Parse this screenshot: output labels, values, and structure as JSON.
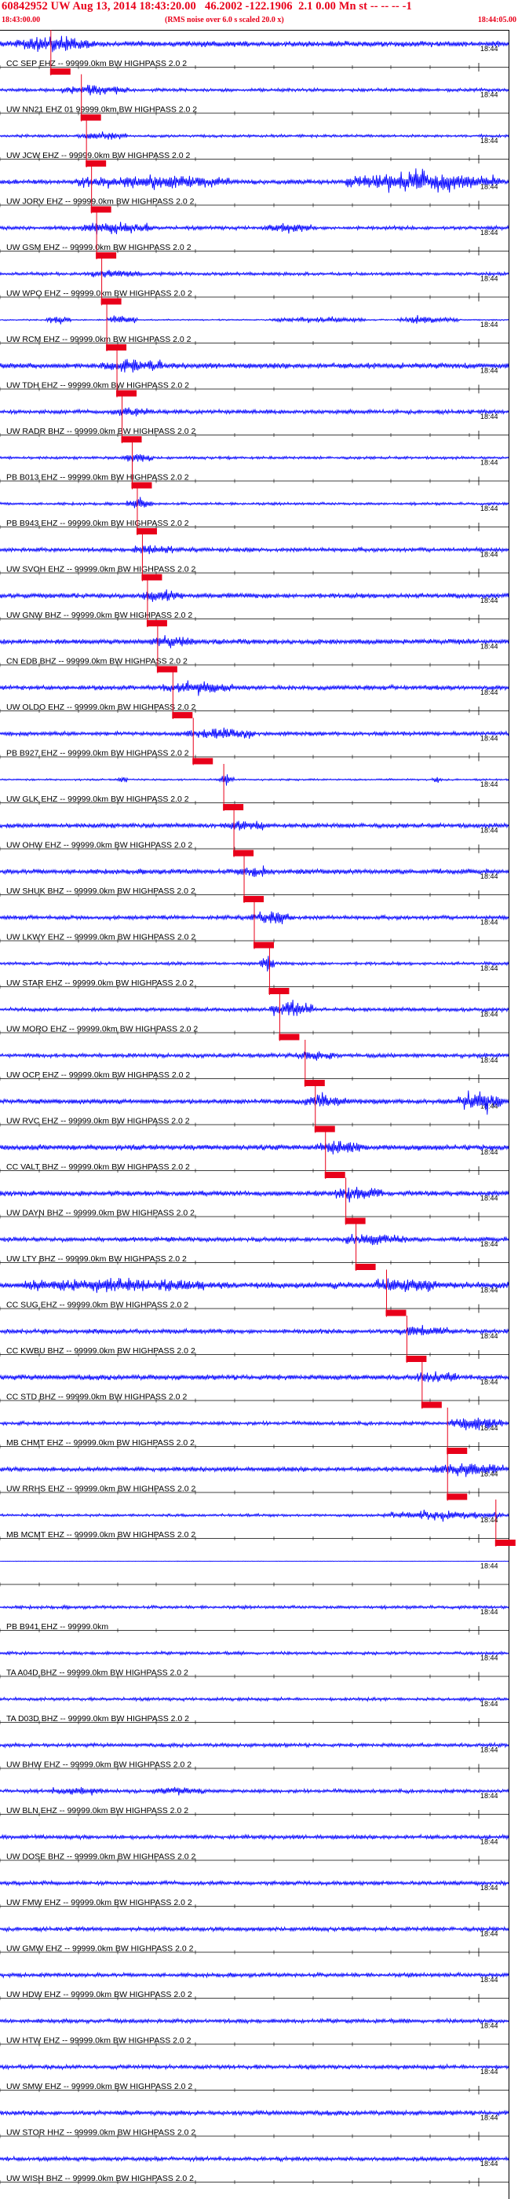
{
  "header": {
    "title": "60842952 UW Aug 13, 2014 18:43:20.00   46.2002 -122.1906  2.1 0.00 Mn st -- -- -- -1",
    "start_time": "18:43:00.00",
    "note": "(RMS noise over 6.0 s scaled 20.0 x)",
    "end_time": "18:44:05.00"
  },
  "chart_data": {
    "type": "seismogram",
    "title": "60842952 UW Aug 13, 2014 18:43:20.00   46.2002 -122.1906  2.1 0.00 Mn st -- -- -- -1",
    "x_range_label": [
      "18:43:00.00",
      "18:44:05.00"
    ],
    "minute_tick_label": "18:44",
    "colors": {
      "trace": "#0000ff",
      "pick": "#e8001a",
      "axis": "#000000"
    },
    "traces": [
      {
        "label": "CC SEP EHZ -- 99999.0km BW  HIGHPASS  2.0  2",
        "amp": 0.6,
        "bursts": [
          [
            0.03,
            0.18,
            2.0
          ]
        ],
        "pick": 0.1
      },
      {
        "label": "UW NN21 EHZ 01 99999.0km BW  HIGHPASS  2.0  2",
        "amp": 0.35,
        "bursts": [
          [
            0.12,
            0.25,
            2.5
          ]
        ],
        "pick": 0.16
      },
      {
        "label": "UW JCW EHZ -- 99999.0km BW  HIGHPASS  2.0  2",
        "amp": 0.3,
        "bursts": [
          [
            0.15,
            0.25,
            2.0
          ]
        ],
        "pick": 0.17
      },
      {
        "label": "UW JORV EHZ -- 99999.0km BW  HIGHPASS  2.0  2",
        "amp": 0.5,
        "bursts": [
          [
            0.15,
            0.45,
            2.2
          ],
          [
            0.68,
            0.99,
            3.5
          ]
        ],
        "pick": 0.18
      },
      {
        "label": "UW GSM EHZ -- 99999.0km BW  HIGHPASS  2.0  2",
        "amp": 0.4,
        "bursts": [
          [
            0.16,
            0.3,
            2.5
          ],
          [
            0.52,
            0.62,
            1.5
          ]
        ],
        "pick": 0.19
      },
      {
        "label": "UW WPO EHZ -- 99999.0km BW  HIGHPASS  2.0  2",
        "amp": 0.35,
        "bursts": [
          [
            0.17,
            0.28,
            1.5
          ]
        ],
        "pick": 0.2
      },
      {
        "label": "UW RCM EHZ -- 99999.0km BW  HIGHPASS  2.0  2",
        "amp": 0.15,
        "bursts": [
          [
            0.09,
            0.14,
            6.0
          ],
          [
            0.21,
            0.27,
            6.0
          ],
          [
            0.53,
            0.72,
            3.5
          ],
          [
            0.78,
            0.9,
            5.0
          ]
        ],
        "pick": 0.21
      },
      {
        "label": "UW TDH EHZ -- 99999.0km BW  HIGHPASS  2.0  2",
        "amp": 0.6,
        "bursts": [
          [
            0.2,
            0.32,
            1.8
          ]
        ],
        "pick": 0.23
      },
      {
        "label": "UW RADR BHZ -- 99999.0km BW  HIGHPASS  2.0  2",
        "amp": 0.45,
        "bursts": [
          [
            0.22,
            0.3,
            1.5
          ]
        ],
        "pick": 0.24
      },
      {
        "label": "PB B013 EHZ -- 99999.0km BW  HIGHPASS  2.0  2",
        "amp": 0.3,
        "bursts": [
          [
            0.24,
            0.3,
            2.5
          ]
        ],
        "pick": 0.26
      },
      {
        "label": "PB B943 EHZ -- 99999.0km BW  HIGHPASS  2.0  2",
        "amp": 0.3,
        "bursts": [
          [
            0.25,
            0.3,
            3.5
          ]
        ],
        "pick": 0.27
      },
      {
        "label": "UW SVOH EHZ -- 99999.0km BW  HIGHPASS  2.0  2",
        "amp": 0.45,
        "bursts": [
          [
            0.26,
            0.34,
            1.8
          ]
        ],
        "pick": 0.28
      },
      {
        "label": "UW GNW BHZ -- 99999.0km BW  HIGHPASS  2.0  2",
        "amp": 0.55,
        "bursts": [
          [
            0.28,
            0.36,
            1.5
          ]
        ],
        "pick": 0.29
      },
      {
        "label": "CN EDB BHZ -- 99999.0km BW  HIGHPASS  2.0  2",
        "amp": 0.55,
        "bursts": [
          [
            0.3,
            0.38,
            1.4
          ]
        ],
        "pick": 0.31
      },
      {
        "label": "UW OLDO EHZ -- 99999.0km BW  HIGHPASS  2.0  2",
        "amp": 0.5,
        "bursts": [
          [
            0.32,
            0.46,
            1.8
          ]
        ],
        "pick": 0.34
      },
      {
        "label": "PB B927 EHZ -- 99999.0km BW  HIGHPASS  2.0  2",
        "amp": 0.45,
        "bursts": [
          [
            0.36,
            0.5,
            1.8
          ]
        ],
        "pick": 0.38
      },
      {
        "label": "UW GLK EHZ -- 99999.0km BW  HIGHPASS  2.0  2",
        "amp": 0.2,
        "bursts": [
          [
            0.43,
            0.46,
            5.0
          ],
          [
            0.23,
            0.25,
            4.0
          ],
          [
            0.85,
            0.87,
            3.0
          ]
        ],
        "pick": 0.44
      },
      {
        "label": "UW OHW EHZ -- 99999.0km BW  HIGHPASS  2.0  2",
        "amp": 0.5,
        "bursts": [
          [
            0.44,
            0.52,
            1.4
          ]
        ],
        "pick": 0.46
      },
      {
        "label": "UW SHUK BHZ -- 99999.0km BW  HIGHPASS  2.0  2",
        "amp": 0.55,
        "bursts": [
          [
            0.46,
            0.54,
            1.4
          ]
        ],
        "pick": 0.48
      },
      {
        "label": "UW LKWY EHZ -- 99999.0km BW  HIGHPASS  2.0  2",
        "amp": 0.45,
        "bursts": [
          [
            0.49,
            0.58,
            2.2
          ]
        ],
        "pick": 0.5
      },
      {
        "label": "UW STAR EHZ -- 99999.0km BW  HIGHPASS  2.0  2",
        "amp": 0.35,
        "bursts": [
          [
            0.51,
            0.54,
            4.0
          ]
        ],
        "pick": 0.53
      },
      {
        "label": "UW MORO EHZ -- 99999.0km BW  HIGHPASS  2.0  2",
        "amp": 0.4,
        "bursts": [
          [
            0.53,
            0.62,
            3.0
          ]
        ],
        "pick": 0.55
      },
      {
        "label": "UW OCP EHZ -- 99999.0km BW  HIGHPASS  2.0  2",
        "amp": 0.45,
        "bursts": [
          [
            0.58,
            0.66,
            1.5
          ]
        ],
        "pick": 0.6
      },
      {
        "label": "UW RVC EHZ -- 99999.0km BW  HIGHPASS  2.0  2",
        "amp": 0.55,
        "bursts": [
          [
            0.6,
            0.68,
            1.8
          ],
          [
            0.9,
            0.99,
            3.0
          ]
        ],
        "pick": 0.62
      },
      {
        "label": "CC VALT BHZ -- 99999.0km BW  HIGHPASS  2.0  2",
        "amp": 0.6,
        "bursts": [
          [
            0.62,
            0.72,
            1.5
          ]
        ],
        "pick": 0.64
      },
      {
        "label": "UW DAYN BHZ -- 99999.0km BW  HIGHPASS  2.0  2",
        "amp": 0.55,
        "bursts": [
          [
            0.65,
            0.75,
            1.8
          ]
        ],
        "pick": 0.68
      },
      {
        "label": "UW LTY BHZ -- 99999.0km BW  HIGHPASS  2.0  2",
        "amp": 0.5,
        "bursts": [
          [
            0.68,
            0.8,
            1.8
          ]
        ],
        "pick": 0.7
      },
      {
        "label": "CC SUG EHZ -- 99999.0km BW  HIGHPASS  2.0  2",
        "amp": 0.7,
        "bursts": [
          [
            0.05,
            0.4,
            1.3
          ],
          [
            0.74,
            0.86,
            1.8
          ]
        ],
        "pick": 0.76
      },
      {
        "label": "CC KWBU BHZ -- 99999.0km BW  HIGHPASS  2.0  2",
        "amp": 0.5,
        "bursts": [
          [
            0.78,
            0.88,
            1.6
          ]
        ],
        "pick": 0.8
      },
      {
        "label": "CC STD BHZ -- 99999.0km BW  HIGHPASS  2.0  2",
        "amp": 0.55,
        "bursts": [
          [
            0.82,
            0.9,
            1.5
          ]
        ],
        "pick": 0.83
      },
      {
        "label": "MB CHMT EHZ -- 99999.0km BW  HIGHPASS  2.0  2",
        "amp": 0.4,
        "bursts": [
          [
            0.88,
            0.99,
            3.0
          ]
        ],
        "pick": 0.88
      },
      {
        "label": "UW RRHS EHZ -- 99999.0km BW  HIGHPASS  2.0  2",
        "amp": 0.5,
        "bursts": [
          [
            0.85,
            0.99,
            2.2
          ]
        ],
        "pick": 0.88
      },
      {
        "label": "MB MCMT EHZ -- 99999.0km BW  HIGHPASS  2.0  2",
        "amp": 0.3,
        "bursts": [
          [
            0.75,
            0.99,
            2.2
          ]
        ],
        "pick": 0.975
      },
      {
        "label": "",
        "amp": 0.05,
        "bursts": [],
        "pick": null
      },
      {
        "label": "PB B941 EHZ -- 99999.0km",
        "amp": 0.35,
        "bursts": [],
        "pick": null
      },
      {
        "label": "TA A04D BHZ -- 99999.0km BW  HIGHPASS  2.0  2",
        "amp": 0.35,
        "bursts": [],
        "pick": null
      },
      {
        "label": "TA D03D BHZ -- 99999.0km BW  HIGHPASS  2.0  2",
        "amp": 0.35,
        "bursts": [],
        "pick": null
      },
      {
        "label": "UW BHW EHZ -- 99999.0km BW  HIGHPASS  2.0  2",
        "amp": 0.4,
        "bursts": [],
        "pick": null
      },
      {
        "label": "UW BLN EHZ -- 99999.0km BW  HIGHPASS  2.0  2",
        "amp": 0.4,
        "bursts": [
          [
            0.1,
            0.2,
            1.5
          ],
          [
            0.3,
            0.4,
            1.3
          ]
        ],
        "pick": null
      },
      {
        "label": "UW DOSE BHZ -- 99999.0km BW  HIGHPASS  2.0  2",
        "amp": 0.45,
        "bursts": [],
        "pick": null
      },
      {
        "label": "UW FMW EHZ -- 99999.0km BW  HIGHPASS  2.0  2",
        "amp": 0.45,
        "bursts": [],
        "pick": null
      },
      {
        "label": "UW GMW EHZ -- 99999.0km BW  HIGHPASS  2.0  2",
        "amp": 0.45,
        "bursts": [],
        "pick": null
      },
      {
        "label": "UW HDW EHZ -- 99999.0km BW  HIGHPASS  2.0  2",
        "amp": 0.45,
        "bursts": [],
        "pick": null
      },
      {
        "label": "UW HTW EHZ -- 99999.0km BW  HIGHPASS  2.0  2",
        "amp": 0.45,
        "bursts": [],
        "pick": null
      },
      {
        "label": "UW SMW EHZ -- 99999.0km BW  HIGHPASS  2.0  2",
        "amp": 0.45,
        "bursts": [],
        "pick": null
      },
      {
        "label": "UW STOR HHZ -- 99999.0km BW  HIGHPASS  2.0  2",
        "amp": 0.5,
        "bursts": [],
        "pick": null
      },
      {
        "label": "UW WISH BHZ -- 99999.0km BW  HIGHPASS  2.0  2",
        "amp": 0.45,
        "bursts": [],
        "pick": null
      }
    ]
  }
}
